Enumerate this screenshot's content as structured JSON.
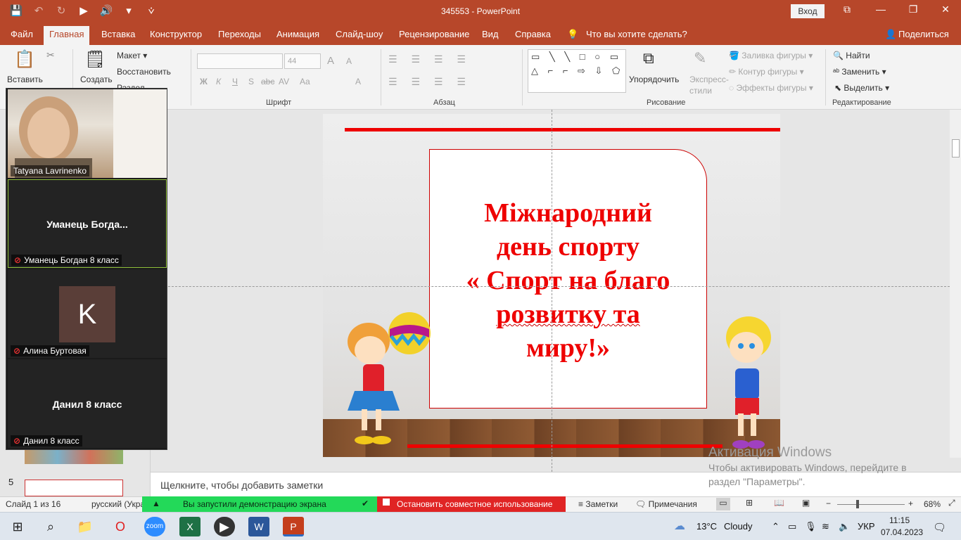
{
  "titlebar": {
    "doc_name": "345553",
    "separator": " - ",
    "app_name": "PowerPoint",
    "signin": "Вход",
    "qat": {
      "save": "💾",
      "undo": "↶",
      "redo": "↻",
      "present": "▶",
      "speaker": "🔊",
      "more": "▾",
      "customize": "⩒"
    }
  },
  "window": {
    "restore_ribbon": "⧉",
    "minimize": "—",
    "maximize": "❐",
    "close": "✕"
  },
  "tabs": [
    "Файл",
    "Главная",
    "Вставка",
    "Конструктор",
    "Переходы",
    "Анимация",
    "Слайд-шоу",
    "Рецензирование",
    "Вид",
    "Справка"
  ],
  "tell_me": "Что вы хотите сделать?",
  "share": "Поделиться",
  "ribbon": {
    "paste": "Вставить",
    "new_slide": "Создать",
    "layout": "Макет",
    "reset": "Восстановить",
    "section": "Раздел",
    "font_group": "Шрифт",
    "font_size": "44",
    "font_buttons": [
      "Ж",
      "К",
      "Ч",
      "S",
      "abc",
      "AV",
      "Aa",
      "A"
    ],
    "grow_shrink": [
      "A",
      "A"
    ],
    "paragraph_group": "Абзац",
    "drawing_group": "Рисование",
    "arrange": "Упорядочить",
    "quick_styles_1": "Экспресс-",
    "quick_styles_2": "стили",
    "fill": "Заливка фигуры",
    "outline": "Контур фигуры",
    "effects": "Эффекты фигуры",
    "shapes_row1": "▭ ╲ ╲ □ ○ ▭",
    "shapes_row2": "△ ⌐ ⌐ ⇨ ⇩ ⬠",
    "shapes_row3": "⌇ ∿ ∿ { } ☆",
    "editing_group": "Редактирование",
    "find": "Найти",
    "replace": "Заменить",
    "select": "Выделить"
  },
  "slide": {
    "title_lines": [
      "Міжнародний",
      "день спорту",
      "« Спорт на благо",
      "розвитку та",
      "миру!»"
    ]
  },
  "thumbnails": {
    "slide5_number": "5"
  },
  "notes_placeholder": "Щелкните, чтобы добавить заметки",
  "watermark": {
    "title": "Активация Windows",
    "line1": "Чтобы активировать Windows, перейдите в",
    "line2": "раздел \"Параметры\"."
  },
  "status": {
    "slide_info": "Слайд 1 из 16",
    "language": "русский (Укра",
    "notes": "Заметки",
    "comments": "Примечания",
    "zoom": "68%",
    "zoom_minus": "−",
    "zoom_plus": "+"
  },
  "screen_share": {
    "started": "Вы запустили демонстрацию экрана",
    "stop": "Остановить совместное использование"
  },
  "zoom_participants": [
    {
      "display": "",
      "name": "Tatyana Lavrinenko",
      "avatar": ""
    },
    {
      "display": "Уманець  Богда...",
      "name": "Уманець Богдан 8 класс",
      "avatar": ""
    },
    {
      "display": "",
      "name": "Алина Буртовая",
      "avatar": "K"
    },
    {
      "display": "Данил 8 класс",
      "name": "Данил 8 класс",
      "avatar": ""
    }
  ],
  "taskbar": {
    "temperature": "13°C",
    "weather": "Cloudy",
    "lang": "УКР",
    "time": "11:15",
    "date": "07.04.2023"
  },
  "colors": {
    "accent": "#b7472a",
    "slide_title": "#ee0000",
    "share_green": "#23d959",
    "share_red": "#e02424"
  }
}
